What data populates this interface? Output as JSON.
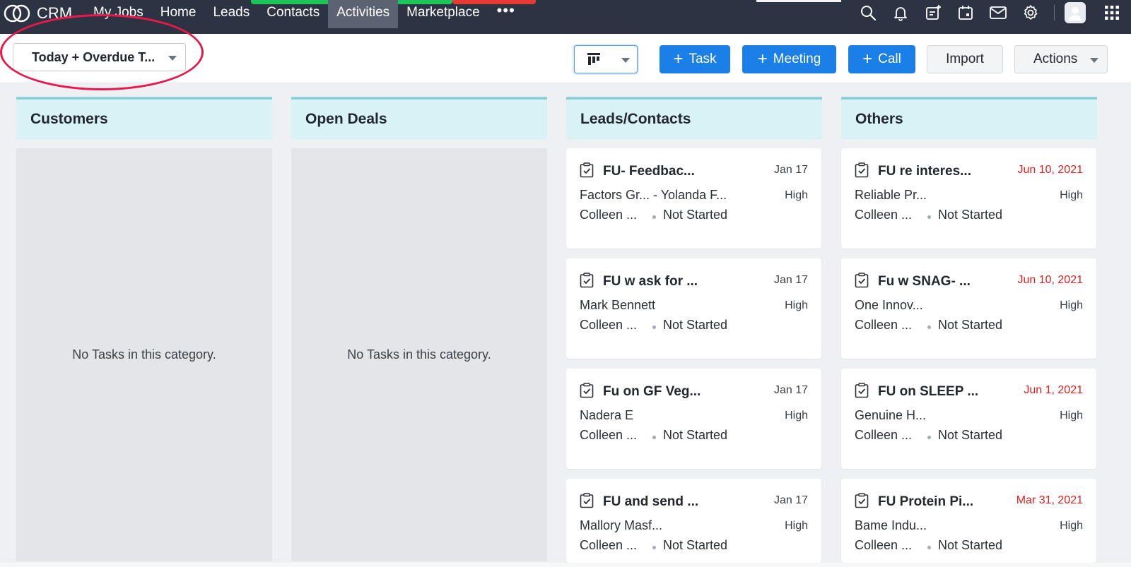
{
  "nav": {
    "brand": "CRM",
    "items": [
      {
        "label": "My Jobs",
        "active": false
      },
      {
        "label": "Home",
        "active": false
      },
      {
        "label": "Leads",
        "active": false
      },
      {
        "label": "Contacts",
        "active": false
      },
      {
        "label": "Activities",
        "active": true
      },
      {
        "label": "Marketplace",
        "active": false
      }
    ],
    "more": "•••",
    "icons": [
      "search-icon",
      "bell-icon",
      "calendar-add-icon",
      "calendar-icon",
      "mail-icon",
      "gear-icon",
      "avatar",
      "apps-grid-icon"
    ]
  },
  "toolbar": {
    "filter_label": "Today + Overdue T...",
    "task_label": "Task",
    "meeting_label": "Meeting",
    "call_label": "Call",
    "import_label": "Import",
    "actions_label": "Actions"
  },
  "colors": {
    "nav_bg": "#2c3444",
    "primary": "#1a7fe6",
    "column_header_bg": "#d9f2f6",
    "overdue": "#e0201f",
    "highlight": "#e8184b"
  },
  "columns": [
    {
      "title": "Customers",
      "empty_text": "No Tasks in this category."
    },
    {
      "title": "Open Deals",
      "empty_text": "No Tasks in this category."
    },
    {
      "title": "Leads/Contacts"
    },
    {
      "title": "Others"
    }
  ],
  "leads_cards": [
    {
      "subject": "FU- Feedbac...",
      "date": "Jan 17",
      "related": "Factors Gr...  - Yolanda F...",
      "priority": "High",
      "owner": "Colleen ...",
      "status": "Not Started"
    },
    {
      "subject": "FU w ask for ...",
      "date": "Jan 17",
      "related": "Mark Bennett",
      "priority": "High",
      "owner": "Colleen ...",
      "status": "Not Started"
    },
    {
      "subject": "Fu on GF Veg...",
      "date": "Jan 17",
      "related": "Nadera E",
      "priority": "High",
      "owner": "Colleen ...",
      "status": "Not Started"
    },
    {
      "subject": "FU and send ...",
      "date": "Jan 17",
      "related": "Mallory Masf...",
      "priority": "High",
      "owner": "Colleen ...",
      "status": "Not Started"
    }
  ],
  "others_cards": [
    {
      "subject": "FU re interes...",
      "date": "Jun 10, 2021",
      "related": "Reliable Pr...",
      "priority": "High",
      "owner": "Colleen ...",
      "status": "Not Started"
    },
    {
      "subject": "Fu w SNAG- ...",
      "date": "Jun 10, 2021",
      "related": "One Innov...",
      "priority": "High",
      "owner": "Colleen ...",
      "status": "Not Started"
    },
    {
      "subject": "FU on SLEEP ...",
      "date": "Jun 1, 2021",
      "related": "Genuine H...",
      "priority": "High",
      "owner": "Colleen ...",
      "status": "Not Started"
    },
    {
      "subject": "FU Protein Pi...",
      "date": "Mar 31, 2021",
      "related": "Bame Indu...",
      "priority": "High",
      "owner": "Colleen ...",
      "status": "Not Started"
    }
  ]
}
